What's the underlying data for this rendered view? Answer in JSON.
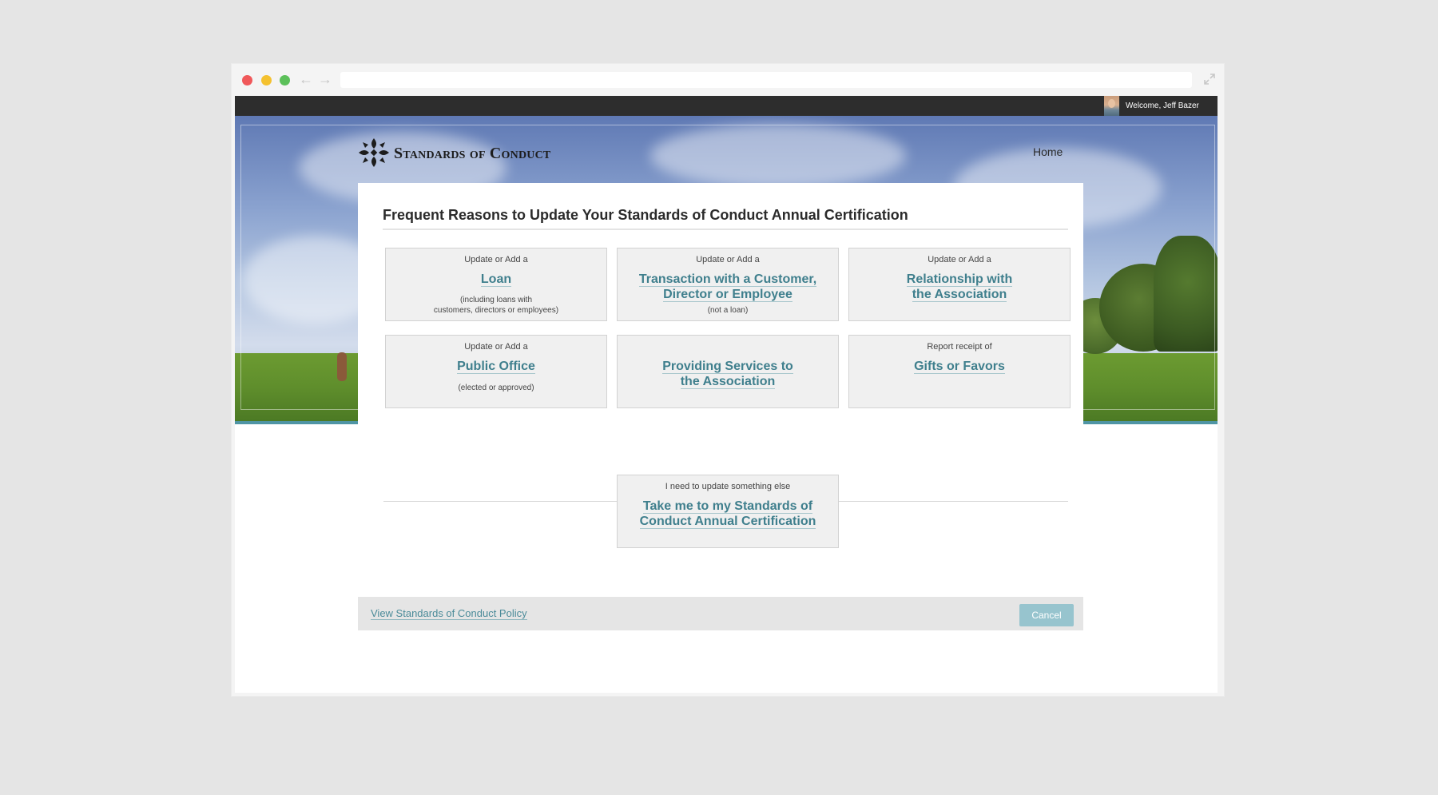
{
  "header": {
    "welcome": "Welcome, Jeff Bazer",
    "brand": "Standards of Conduct",
    "home_label": "Home"
  },
  "page": {
    "title": "Frequent Reasons to Update Your Standards of Conduct Annual Certification"
  },
  "cards": [
    {
      "pre": "Update or Add a",
      "link_lines": [
        "Loan"
      ],
      "note_lines": [
        "(including loans with",
        "customers, directors or employees)"
      ]
    },
    {
      "pre": "Update or Add a",
      "link_lines": [
        "Transaction with a Customer,",
        "Director or Employee"
      ],
      "note_lines": [
        "(not a loan)"
      ]
    },
    {
      "pre": "Update or Add a",
      "link_lines": [
        "Relationship with",
        "the Association"
      ],
      "note_lines": []
    },
    {
      "pre": "Update or Add a",
      "link_lines": [
        "Public Office"
      ],
      "note_lines": [
        "(elected or approved)"
      ]
    },
    {
      "pre": "",
      "link_lines": [
        "Providing Services to",
        "the Association"
      ],
      "note_lines": []
    },
    {
      "pre": "Report receipt of",
      "link_lines": [
        "Gifts or Favors"
      ],
      "note_lines": []
    }
  ],
  "other_card": {
    "pre": "I need to update something else",
    "link_lines": [
      "Take me to my Standards of",
      "Conduct Annual Certification"
    ]
  },
  "footer": {
    "policy_link": "View Standards of Conduct Policy",
    "cancel_label": "Cancel"
  },
  "colors": {
    "link": "#3f7f8d",
    "accent_border": "#4f95a4",
    "cancel_bg": "#97c4ce",
    "topbar": "#2d2d2d"
  }
}
